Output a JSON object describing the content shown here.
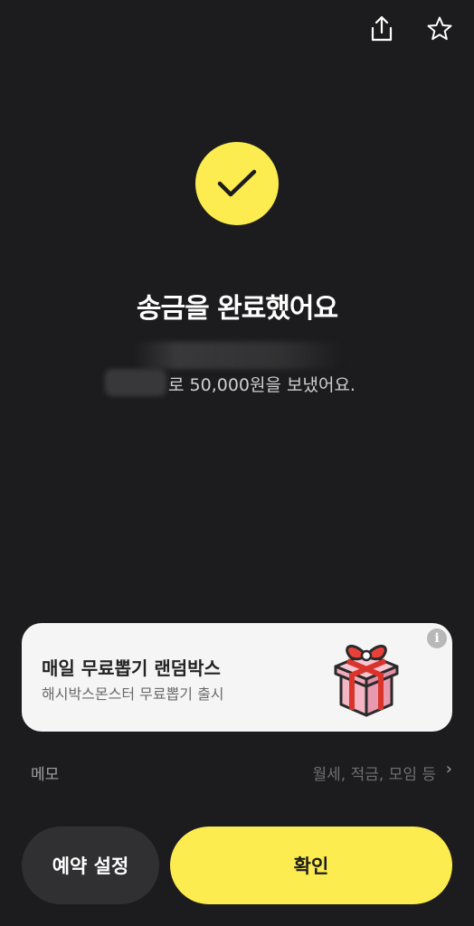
{
  "header": {
    "share_icon": "share-icon",
    "star_icon": "star-icon"
  },
  "result": {
    "title": "송금을 완료했어요",
    "subtitle": "로 50,000원을 보냈어요."
  },
  "ad": {
    "title": "매일 무료뽑기 랜덤박스",
    "subtitle": "해시박스몬스터 무료뽑기 출시",
    "info_glyph": "i"
  },
  "memo": {
    "label": "메모",
    "hint": "월세, 적금, 모임 등",
    "chevron": "›"
  },
  "buttons": {
    "reserve_label": "예약 설정",
    "confirm_label": "확인"
  },
  "colors": {
    "background": "#1c1c1e",
    "accent": "#fdec4f",
    "card": "#f5f5f5"
  }
}
